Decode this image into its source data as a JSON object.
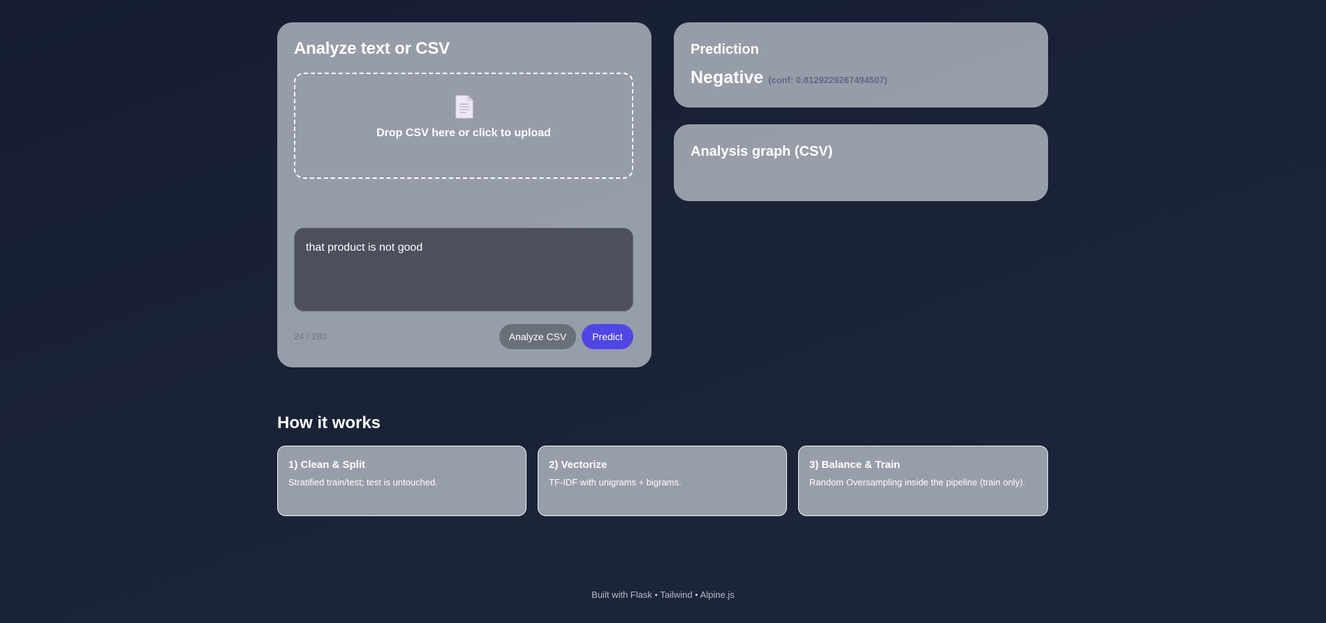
{
  "analyze": {
    "title": "Analyze text or CSV",
    "dropzone": {
      "icon": "document-icon",
      "title": "Drop CSV here or click to upload"
    },
    "textarea_value": "that product is not good",
    "char_count": "24 / 280",
    "analyze_csv_label": "Analyze CSV",
    "predict_label": "Predict"
  },
  "prediction": {
    "title": "Prediction",
    "label": "Negative",
    "confidence": "(conf: 0.8129229267494507)"
  },
  "graph": {
    "title": "Analysis graph (CSV)"
  },
  "how_it_works": {
    "title": "How it works",
    "steps": [
      {
        "title": "1) Clean & Split",
        "desc": "Stratified train/test; test is untouched."
      },
      {
        "title": "2) Vectorize",
        "desc": "TF-IDF with unigrams + bigrams."
      },
      {
        "title": "3) Balance & Train",
        "desc": "Random Oversampling inside the pipeline (train only)."
      }
    ]
  },
  "footer": "Built with Flask • Tailwind • Alpine.js",
  "colors": {
    "accent": "#4f46e5",
    "secondary_button": "#6a7079",
    "background": "#161d33"
  }
}
